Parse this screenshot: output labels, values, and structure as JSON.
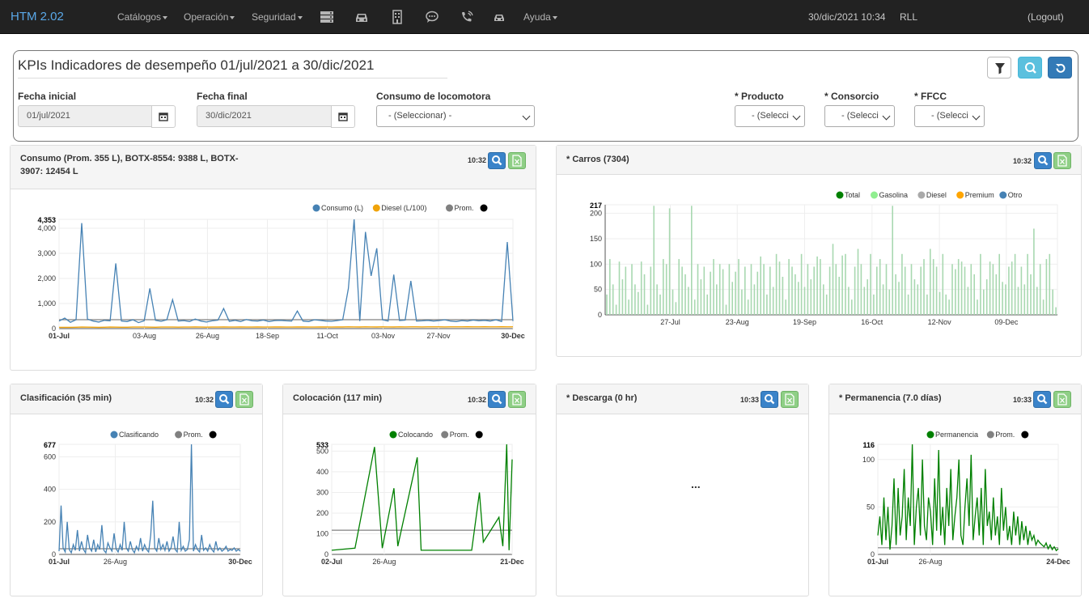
{
  "navbar": {
    "brand": "HTM 2.02",
    "menus": [
      "Catálogos",
      "Operación",
      "Seguridad"
    ],
    "icons": [
      "server-icon",
      "car-icon",
      "building-icon",
      "chat-icon",
      "phone-icon",
      "car-small-icon"
    ],
    "help": "Ayuda",
    "datetime": "30/dic/2021 10:34",
    "user": "RLL",
    "logout": "(Logout)"
  },
  "filters": {
    "title": "KPIs Indicadores de desempeño 01/jul/2021 a 30/dic/2021",
    "start_label": "Fecha inicial",
    "start_value": "01/jul/2021",
    "end_label": "Fecha final",
    "end_value": "30/dic/2021",
    "consumo_label": "Consumo de locomotora",
    "consumo_value": "- (Seleccionar) -",
    "producto_label": "* Producto",
    "producto_value": "- (Selecci",
    "consorcio_label": "* Consorcio",
    "consorcio_value": "- (Selecci",
    "ffcc_label": "* FFCC",
    "ffcc_value": "- (Selecci"
  },
  "panels": {
    "consumo": {
      "title": "Consumo (Prom. 355 L), BOTX-8554: 9388 L, BOTX-3907: 12454 L",
      "time": "10:32"
    },
    "carros": {
      "title": "* Carros (7304)",
      "time": "10:32"
    },
    "clasificacion": {
      "title": "Clasificación (35 min)",
      "time": "10:32"
    },
    "colocacion": {
      "title": "Colocación (117 min)",
      "time": "10:32"
    },
    "descarga": {
      "title": "* Descarga (0 hr)",
      "time": "10:33",
      "empty_text": "..."
    },
    "permanencia": {
      "title": "* Permanencia (7.0 días)",
      "time": "10:33"
    }
  },
  "chart_data": [
    {
      "type": "line",
      "name": "consumo",
      "series": [
        {
          "name": "Consumo (L)",
          "color": "#4682b4",
          "values": [
            300,
            420,
            250,
            350,
            4200,
            380,
            300,
            260,
            330,
            310,
            2600,
            300,
            280,
            350,
            240,
            310,
            1600,
            330,
            290,
            350,
            1150,
            300,
            320,
            280,
            380,
            300,
            260,
            310,
            340,
            800,
            290,
            330,
            280,
            360,
            310,
            300,
            340,
            280,
            320,
            330,
            310,
            300,
            700,
            300,
            280,
            350,
            330,
            300,
            290,
            320,
            350,
            1600,
            4353,
            300,
            3850,
            2100,
            3200,
            350,
            300,
            2150,
            320,
            340,
            1900,
            300,
            310,
            330,
            300,
            320,
            350,
            300,
            280,
            320,
            300,
            340,
            310,
            330,
            300,
            350,
            280,
            3450,
            300
          ]
        },
        {
          "name": "Diesel (L/100)",
          "color": "#f0a30a",
          "values": [
            50,
            50,
            52,
            55,
            60,
            58,
            55,
            52,
            55,
            60,
            58,
            55,
            56,
            60,
            62,
            60,
            58,
            55,
            60,
            62,
            60,
            58,
            60,
            62,
            64,
            60,
            58,
            60,
            62,
            65,
            60,
            62,
            64,
            60,
            62,
            65,
            60,
            62,
            64,
            66,
            62,
            60,
            64,
            66,
            62,
            60,
            64,
            66,
            62,
            64,
            66,
            70,
            68,
            66,
            70,
            68,
            66,
            70,
            68,
            66,
            70,
            68,
            70,
            72,
            68,
            70,
            72,
            70,
            68,
            72,
            70,
            72,
            74,
            70,
            72,
            74,
            72,
            70,
            74,
            72,
            70
          ]
        },
        {
          "name": "Prom.",
          "color": "#808080",
          "values": [
            355
          ]
        },
        {
          "name": "",
          "color": "#000000",
          "values": []
        }
      ],
      "x_ticks": [
        "01-Jul",
        "03-Aug",
        "26-Aug",
        "18-Sep",
        "11-Oct",
        "03-Nov",
        "27-Nov",
        "30-Dec"
      ],
      "y_ticks": [
        0,
        1000,
        2000,
        3000,
        4000
      ],
      "y_max_label": "4,353",
      "ylim": [
        0,
        4353
      ]
    },
    {
      "type": "bar",
      "name": "carros",
      "series": [
        {
          "name": "Total",
          "color": "#008000"
        },
        {
          "name": "Gasolina",
          "color": "#90ee90"
        },
        {
          "name": "Diesel",
          "color": "#a9a9a9"
        },
        {
          "name": "Premium",
          "color": "#ffa500"
        },
        {
          "name": "Otro",
          "color": "#4682b4"
        }
      ],
      "values": [
        40,
        110,
        60,
        20,
        105,
        70,
        95,
        30,
        100,
        60,
        45,
        105,
        80,
        20,
        95,
        215,
        60,
        40,
        110,
        100,
        210,
        50,
        25,
        110,
        95,
        80,
        55,
        215,
        30,
        100,
        70,
        95,
        40,
        85,
        110,
        60,
        100,
        90,
        20,
        100,
        65,
        85,
        110,
        50,
        95,
        30,
        100,
        60,
        85,
        115,
        100,
        40,
        95,
        55,
        120,
        105,
        75,
        30,
        110,
        95,
        80,
        65,
        120,
        55,
        100,
        70,
        95,
        115,
        110,
        60,
        40,
        95,
        140,
        100,
        75,
        117,
        120,
        55,
        30,
        95,
        130,
        100,
        55,
        70,
        120,
        40,
        95,
        110,
        60,
        100,
        50,
        215,
        80,
        65,
        120,
        95,
        40,
        100,
        70,
        60,
        95,
        110,
        40,
        130,
        110,
        95,
        45,
        120,
        40,
        30,
        100,
        90,
        110,
        105,
        95,
        55,
        100,
        80,
        30,
        120,
        50,
        70,
        105,
        100,
        80,
        120,
        65,
        60,
        95,
        105,
        120,
        55,
        95,
        60,
        120,
        80,
        170,
        55,
        100,
        30,
        110,
        120,
        50,
        15
      ],
      "x_ticks": [
        "27-Jul",
        "23-Aug",
        "19-Sep",
        "16-Oct",
        "12-Nov",
        "09-Dec"
      ],
      "y_ticks": [
        0,
        50,
        100,
        150,
        200
      ],
      "y_max_label": "217",
      "ylim": [
        0,
        217
      ]
    },
    {
      "type": "line",
      "name": "clasificacion",
      "series": [
        {
          "name": "Clasificando",
          "color": "#4682b4",
          "values": [
            20,
            300,
            40,
            15,
            200,
            30,
            10,
            60,
            25,
            150,
            20,
            80,
            30,
            10,
            120,
            40,
            20,
            90,
            15,
            60,
            30,
            180,
            25,
            10,
            70,
            40,
            20,
            130,
            35,
            15,
            60,
            25,
            200,
            40,
            20,
            80,
            30,
            10,
            50,
            25,
            100,
            20,
            60,
            30,
            15,
            120,
            330,
            40,
            20,
            100,
            30,
            60,
            25,
            80,
            20,
            40,
            110,
            30,
            15,
            200,
            25,
            50,
            20,
            30,
            90,
            677,
            20,
            60,
            30,
            15,
            120,
            25,
            40,
            20,
            60,
            30,
            15,
            80,
            25,
            40,
            20,
            30,
            50,
            20,
            30,
            25,
            40,
            20,
            30,
            20
          ]
        },
        {
          "name": "Prom.",
          "color": "#808080",
          "values": [
            35
          ]
        },
        {
          "name": "",
          "color": "#000000",
          "values": []
        }
      ],
      "x_ticks": [
        "01-Jul",
        "26-Aug",
        "30-Dec"
      ],
      "y_ticks": [
        0,
        200,
        400,
        600
      ],
      "y_max_label": "677",
      "ylim": [
        0,
        677
      ]
    },
    {
      "type": "line",
      "name": "colocacion",
      "series": [
        {
          "name": "Colocando",
          "color": "#008000",
          "values": [
            [
              0,
              20
            ],
            [
              30,
              30
            ],
            [
              55,
              520
            ],
            [
              65,
              30
            ],
            [
              80,
              320
            ],
            [
              85,
              40
            ],
            [
              110,
              470
            ],
            [
              115,
              20
            ],
            [
              180,
              20
            ],
            [
              190,
              300
            ],
            [
              195,
              60
            ],
            [
              215,
              180
            ],
            [
              220,
              40
            ],
            [
              225,
              533
            ],
            [
              228,
              20
            ],
            [
              232,
              460
            ]
          ]
        },
        {
          "name": "Prom.",
          "color": "#808080",
          "values": [
            117
          ]
        },
        {
          "name": "",
          "color": "#000000",
          "values": []
        }
      ],
      "x_ticks": [
        "02-Jul",
        "26-Aug",
        "21-Dec"
      ],
      "y_ticks": [
        0,
        100,
        200,
        300,
        400,
        500
      ],
      "y_max_label": "533",
      "ylim": [
        0,
        533
      ]
    },
    {
      "type": "line",
      "name": "permanencia",
      "series": [
        {
          "name": "Permanencia",
          "color": "#008000",
          "values": [
            20,
            40,
            10,
            60,
            15,
            50,
            5,
            30,
            80,
            10,
            70,
            20,
            40,
            90,
            15,
            60,
            30,
            116,
            10,
            50,
            70,
            20,
            100,
            30,
            15,
            60,
            45,
            10,
            80,
            25,
            110,
            20,
            50,
            10,
            70,
            30,
            90,
            15,
            40,
            60,
            100,
            20,
            10,
            50,
            80,
            30,
            105,
            15,
            40,
            60,
            20,
            70,
            10,
            90,
            30,
            45,
            15,
            60,
            20,
            40,
            10,
            70,
            25,
            50,
            15,
            30,
            10,
            45,
            20,
            40,
            10,
            35,
            15,
            30,
            10,
            25,
            15,
            20,
            10,
            15,
            12,
            10,
            8,
            12,
            6,
            10,
            5,
            8,
            4,
            6
          ]
        },
        {
          "name": "Prom.",
          "color": "#808080",
          "values": [
            7
          ]
        },
        {
          "name": "",
          "color": "#000000",
          "values": []
        }
      ],
      "x_ticks": [
        "01-Jul",
        "26-Aug",
        "24-Dec"
      ],
      "y_ticks": [
        0,
        50,
        100
      ],
      "y_max_label": "116",
      "ylim": [
        0,
        116
      ]
    }
  ]
}
